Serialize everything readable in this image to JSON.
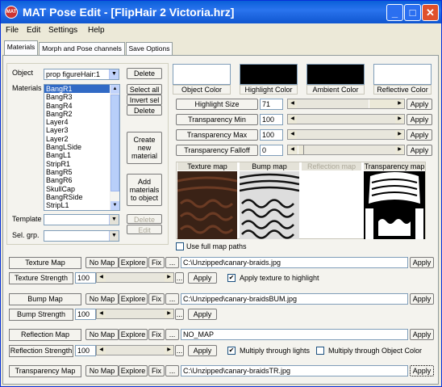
{
  "window": {
    "title": "MAT Pose Edit - [FlipHair 2 Victoria.hrz]",
    "icon_text": "MAT"
  },
  "menu": [
    "File",
    "Edit",
    "Settings",
    "Help"
  ],
  "tabs": [
    "Materials",
    "Morph and Pose channels",
    "Save Options"
  ],
  "object": {
    "label": "Object",
    "value": "prop figureHair:1",
    "delete": "Delete"
  },
  "materials": {
    "label": "Materials",
    "items": [
      "BangR1",
      "BangR3",
      "BangR4",
      "BangR2",
      "Layer4",
      "Layer3",
      "Layer2",
      "BangLSide",
      "BangL1",
      "StripR1",
      "BangR5",
      "BangR6",
      "SkullCap",
      "BangRSide",
      "StripL1"
    ],
    "select_all": "Select all",
    "invert_sel": "Invert sel",
    "delete": "Delete",
    "create": "Create new material",
    "add": "Add materials to object"
  },
  "template": {
    "label": "Template",
    "delete": "Delete",
    "edit": "Edit"
  },
  "sel_grp": {
    "label": "Sel. grp."
  },
  "colors": [
    "Object Color",
    "Highlight Color",
    "Ambient Color",
    "Reflective Color"
  ],
  "color_values": [
    "#ffffff",
    "#000000",
    "#000000",
    "#ffffff"
  ],
  "props": [
    {
      "label": "Highlight Size",
      "value": "71",
      "apply": "Apply"
    },
    {
      "label": "Transparency Min",
      "value": "100",
      "apply": "Apply"
    },
    {
      "label": "Transparency Max",
      "value": "100",
      "apply": "Apply"
    },
    {
      "label": "Transparency Falloff",
      "value": "0",
      "apply": "Apply"
    }
  ],
  "maps": [
    "Texture map",
    "Bump map",
    "Reflection map",
    "Transparency map"
  ],
  "use_full_paths": "Use full map paths",
  "rows": {
    "texture_map": {
      "label": "Texture Map",
      "path": "C:\\Unzipped\\canary-braids.jpg"
    },
    "texture_strength": {
      "label": "Texture Strength",
      "value": "100",
      "check": "Apply texture to highlight"
    },
    "bump_map": {
      "label": "Bump Map",
      "path": "C:\\Unzipped\\canary-braidsBUM.jpg"
    },
    "bump_strength": {
      "label": "Bump Strength",
      "value": "100"
    },
    "reflection_map": {
      "label": "Reflection Map",
      "path": "NO_MAP"
    },
    "reflection_strength": {
      "label": "Reflection Strength",
      "value": "100",
      "check1": "Multiply through lights",
      "check2": "Multiply through Object Color"
    },
    "transparency_map": {
      "label": "Transparency Map",
      "path": "C:\\Unzipped\\canary-braidsTR.jpg"
    }
  },
  "common": {
    "no_map": "No Map",
    "explore": "Explore",
    "fix": "Fix",
    "ellipsis": "...",
    "apply": "Apply"
  }
}
